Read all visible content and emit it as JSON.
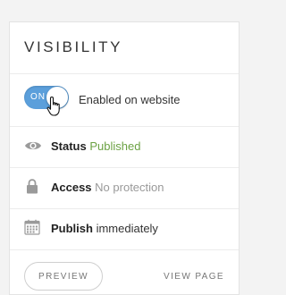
{
  "panel": {
    "title": "VISIBILITY"
  },
  "toggle": {
    "state_label": "ON",
    "description": "Enabled on website",
    "accent_color": "#5b9fdb"
  },
  "status": {
    "label": "Status",
    "value": "Published",
    "value_color": "#6ca244",
    "icon": "eye-icon"
  },
  "access": {
    "label": "Access",
    "value": "No protection",
    "icon": "lock-icon"
  },
  "publish": {
    "label": "Publish",
    "value": "immediately",
    "icon": "calendar-icon"
  },
  "actions": {
    "preview_label": "PREVIEW",
    "view_page_label": "VIEW PAGE"
  }
}
